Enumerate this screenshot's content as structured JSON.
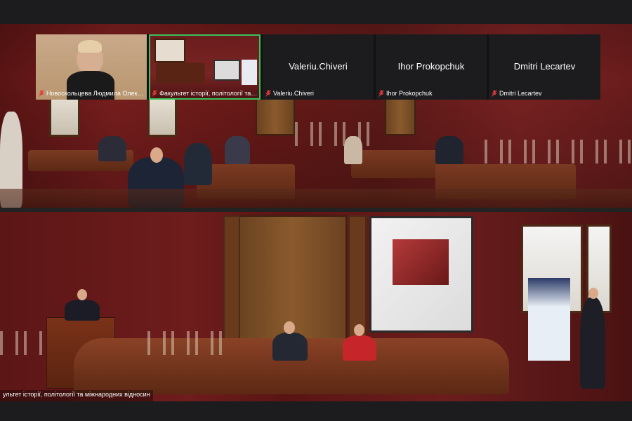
{
  "participants": [
    {
      "display_name": "",
      "label": "Новоскольцева Людмила Олексан...",
      "muted": true,
      "has_video": true
    },
    {
      "display_name": "",
      "label": "Факультет історії, політології та міжна...",
      "muted": true,
      "has_video": true,
      "active_speaker": true
    },
    {
      "display_name": "Valeriu.Chiveri",
      "label": "Valeriu.Chiveri",
      "muted": true,
      "has_video": false
    },
    {
      "display_name": "Ihor Prokopchuk",
      "label": "Ihor Prokopchuk",
      "muted": true,
      "has_video": false
    },
    {
      "display_name": "Dmitri Lecartev",
      "label": "Dmitri Lecartev",
      "muted": true,
      "has_video": false
    }
  ],
  "main_video": {
    "name_label": "ультет історії, політології та міжнародних відносин"
  },
  "colors": {
    "active_speaker_border": "#39c15a",
    "muted_icon": "#e5393b",
    "tile_background": "#1c1c1e"
  },
  "icons": {
    "muted": "microphone-muted-icon"
  }
}
